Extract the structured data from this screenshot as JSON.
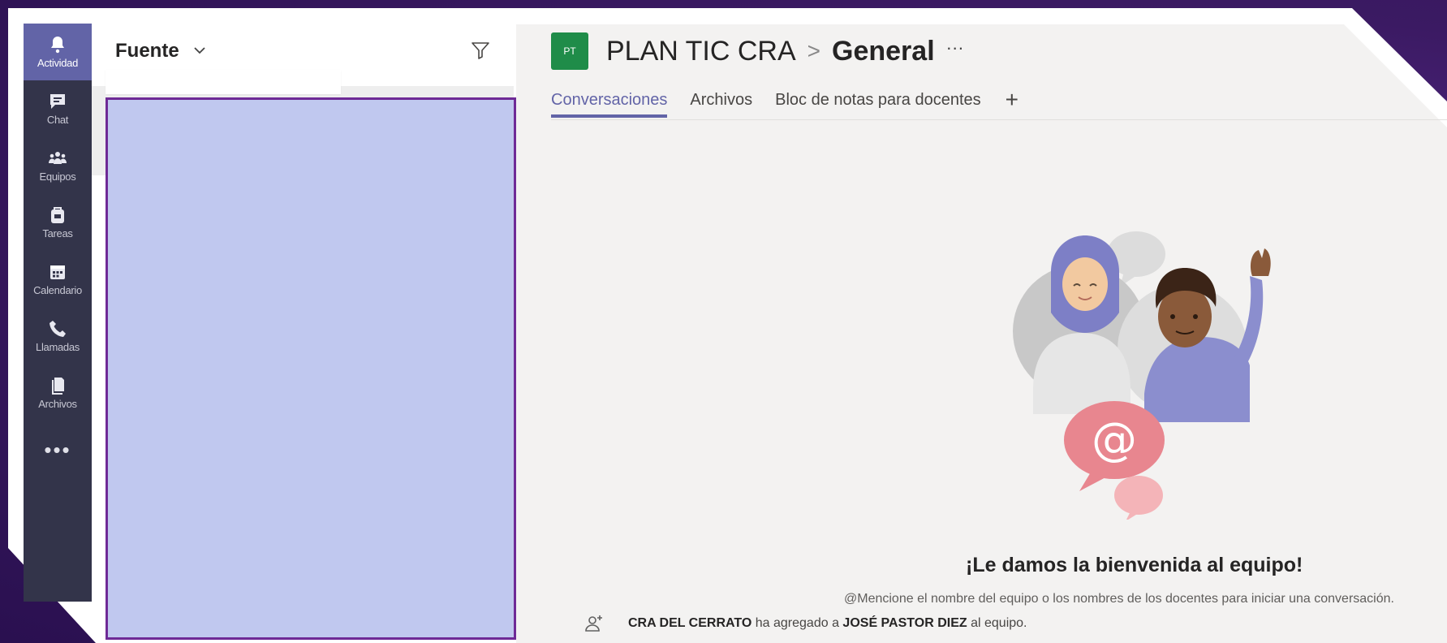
{
  "rail": {
    "items": [
      {
        "label": "Actividad",
        "icon": "bell-icon",
        "active": true
      },
      {
        "label": "Chat",
        "icon": "chat-icon"
      },
      {
        "label": "Equipos",
        "icon": "teams-icon"
      },
      {
        "label": "Tareas",
        "icon": "assignments-icon"
      },
      {
        "label": "Calendario",
        "icon": "calendar-icon"
      },
      {
        "label": "Llamadas",
        "icon": "phone-icon"
      },
      {
        "label": "Archivos",
        "icon": "files-icon"
      }
    ],
    "more": "•••"
  },
  "feed": {
    "title": "Fuente"
  },
  "team": {
    "avatar": "PT",
    "name": "PLAN TIC CRA",
    "separator": ">",
    "channel": "General",
    "more": "···"
  },
  "tabs": [
    {
      "label": "Conversaciones",
      "active": true
    },
    {
      "label": "Archivos"
    },
    {
      "label": "Bloc de notas para docentes"
    }
  ],
  "tab_add": "+",
  "welcome": {
    "title": "¡Le damos la bienvenida al equipo!",
    "subtitle": "@Mencione el nombre del equipo o los nombres de los docentes para iniciar una conversación."
  },
  "event": {
    "actor": "CRA DEL CERRATO",
    "action": "ha agregado a",
    "target": "JOSÉ PASTOR DIEZ",
    "suffix": "al equipo."
  },
  "colors": {
    "rail_bg": "#33344a",
    "accent": "#6264a7",
    "team_avatar": "#1f8c49",
    "highlight_fill": "#c0c8ef",
    "highlight_border": "#6e2a96"
  }
}
